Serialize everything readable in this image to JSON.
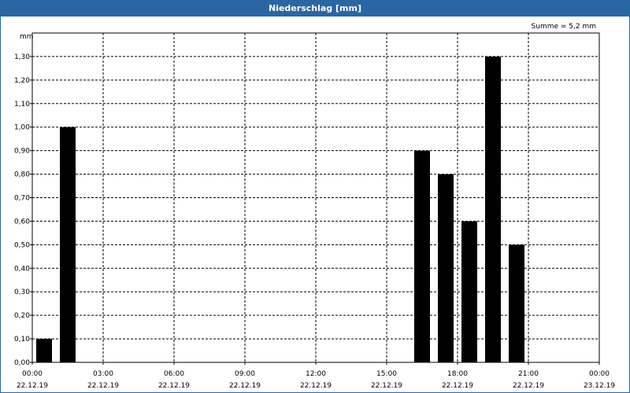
{
  "window": {
    "title": "Niederschlag [mm]"
  },
  "colors": {
    "titlebar": "#2a66a3",
    "bar": "#000000",
    "grid": "#000000"
  },
  "chart_data": {
    "type": "bar",
    "title": "Niederschlag [mm]",
    "ylabel": "mm",
    "summary": "Summe = 5,2 mm",
    "ylim": [
      0,
      1.4
    ],
    "y_ticks": [
      "0,00",
      "0,10",
      "0,20",
      "0,30",
      "0,40",
      "0,50",
      "0,60",
      "0,70",
      "0,80",
      "0,90",
      "1,00",
      "1,10",
      "1,20",
      "1,30"
    ],
    "xlim_hours": [
      0,
      24
    ],
    "x_ticks": [
      {
        "time": "00:00",
        "date": "22.12.19"
      },
      {
        "time": "03:00",
        "date": "22.12.19"
      },
      {
        "time": "06:00",
        "date": "22.12.19"
      },
      {
        "time": "09:00",
        "date": "22.12.19"
      },
      {
        "time": "12:00",
        "date": "22.12.19"
      },
      {
        "time": "15:00",
        "date": "22.12.19"
      },
      {
        "time": "18:00",
        "date": "22.12.19"
      },
      {
        "time": "21:00",
        "date": "22.12.19"
      },
      {
        "time": "00:00",
        "date": "23.12.19"
      }
    ],
    "grid": true,
    "bars": [
      {
        "time": "00:00",
        "value": 0.1
      },
      {
        "time": "01:00",
        "value": 1.0
      },
      {
        "time": "16:00",
        "value": 0.9
      },
      {
        "time": "17:00",
        "value": 0.8
      },
      {
        "time": "18:00",
        "value": 0.6
      },
      {
        "time": "19:00",
        "value": 1.3
      },
      {
        "time": "20:00",
        "value": 0.5
      }
    ]
  }
}
